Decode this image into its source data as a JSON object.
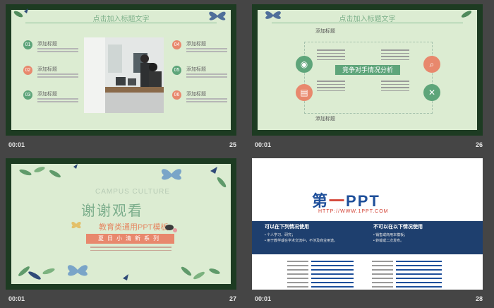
{
  "slides": [
    {
      "time": "00:01",
      "number": "25",
      "title": "点击加入标题文字",
      "items": [
        {
          "num": "01",
          "label": "添加标题"
        },
        {
          "num": "02",
          "label": "添加标题"
        },
        {
          "num": "03",
          "label": "添加标题"
        },
        {
          "num": "04",
          "label": "添加标题"
        },
        {
          "num": "05",
          "label": "添加标题"
        },
        {
          "num": "06",
          "label": "添加标题"
        }
      ]
    },
    {
      "time": "00:01",
      "number": "26",
      "title": "点击加入标题文字",
      "center_label": "竞争对手情况分析",
      "top_title": "添加标题",
      "bottom_title": "添加标题"
    },
    {
      "time": "00:01",
      "number": "27",
      "campus": "CAMPUS CULTURE",
      "heading": "谢谢观看",
      "subtitle": "教育类通用PPT模板",
      "ribbon": "夏日小清新系列"
    },
    {
      "time": "00:01",
      "number": "28",
      "logo_main": "第",
      "logo_dash": "一",
      "logo_tail": "PPT",
      "url": "HTTP://WWW.1PPT.COM",
      "left_heading": "可以在下列情况使用",
      "right_heading": "不可以在以下情况使用",
      "left_line1": "• 个人学习、研究；",
      "left_line2": "• 用于教学或在学术交流中，不涉及商业用途。",
      "right_line1": "• 销售或商用本模板；",
      "right_line2": "• 转载或二次发布。"
    }
  ],
  "colors": {
    "green": "#5ea57a",
    "salmon": "#e8886d",
    "navy": "#1e3f6e",
    "blue_logo": "#1e4f9a",
    "red_accent": "#d23c2e"
  }
}
